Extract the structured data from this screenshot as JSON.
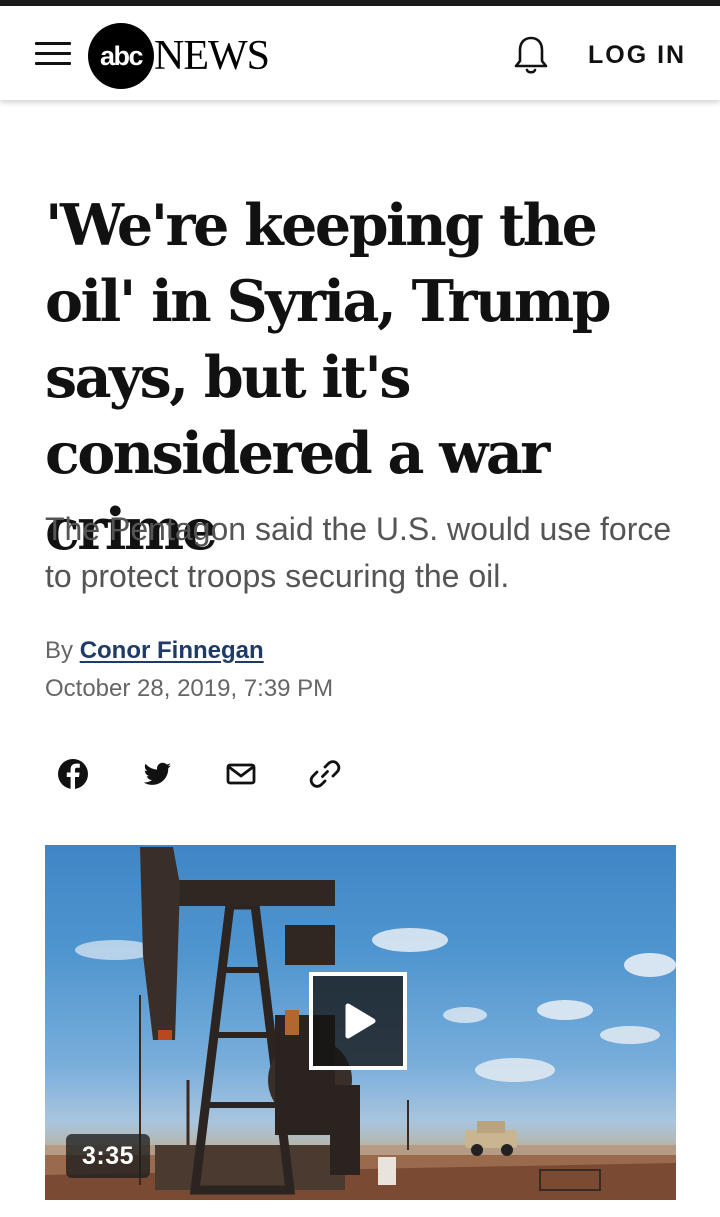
{
  "header": {
    "brand_logo_text": "abc",
    "brand_news_text": "NEWS",
    "login_label": "LOG IN"
  },
  "article": {
    "headline": "'We're keeping the oil' in Syria, Trump says, but it's considered a war crime",
    "subhead": "The Pentagon said the U.S. would use force to protect troops securing the oil.",
    "byline_prefix": "By ",
    "author": "Conor Finnegan",
    "date": "October 28, 2019, 7:39 PM"
  },
  "share": {
    "icons": [
      "facebook-icon",
      "twitter-icon",
      "email-icon",
      "link-icon"
    ]
  },
  "video": {
    "duration": "3:35"
  },
  "colors": {
    "byline_link": "#1d3b66",
    "subhead_text": "#555555",
    "meta_text": "#666666"
  }
}
